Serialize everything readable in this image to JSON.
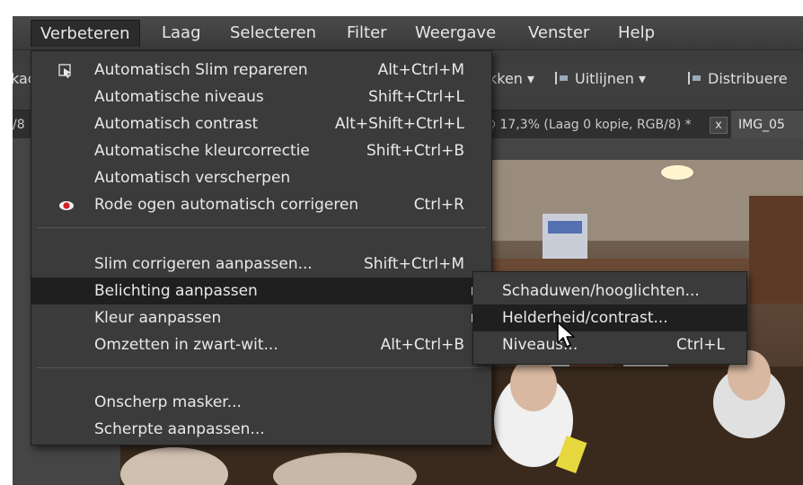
{
  "menubar": {
    "items": [
      {
        "label": "Verbeteren"
      },
      {
        "label": "Laag"
      },
      {
        "label": "Selecteren"
      },
      {
        "label": "Filter"
      },
      {
        "label": "Weergave"
      },
      {
        "label": "Venster"
      },
      {
        "label": "Help"
      }
    ]
  },
  "toolbar": {
    "left_fragment": "kac",
    "arrange_label": "kken ▾",
    "align_label": "Uitlijnen ▾",
    "distribute_label": "Distribuere"
  },
  "tabs": {
    "left_fragment": "/8",
    "doc_title": "@ 17,3% (Laag 0 kopie, RGB/8) *",
    "close_label": "x",
    "next_doc": "IMG_05"
  },
  "menu": {
    "items": [
      {
        "label": "Automatisch Slim repareren",
        "shortcut": "Alt+Ctrl+M"
      },
      {
        "label": "Automatische niveaus",
        "shortcut": "Shift+Ctrl+L"
      },
      {
        "label": "Automatisch contrast",
        "shortcut": "Alt+Shift+Ctrl+L"
      },
      {
        "label": "Automatische kleurcorrectie",
        "shortcut": "Shift+Ctrl+B"
      },
      {
        "label": "Automatisch verscherpen",
        "shortcut": ""
      },
      {
        "label": "Rode ogen automatisch corrigeren",
        "shortcut": "Ctrl+R"
      },
      {
        "label": "Slim corrigeren aanpassen...",
        "shortcut": "Shift+Ctrl+M"
      },
      {
        "label": "Belichting aanpassen",
        "shortcut": ""
      },
      {
        "label": "Kleur aanpassen",
        "shortcut": ""
      },
      {
        "label": "Omzetten in zwart-wit...",
        "shortcut": "Alt+Ctrl+B"
      },
      {
        "label": "Onscherp masker...",
        "shortcut": ""
      },
      {
        "label": "Scherpte aanpassen...",
        "shortcut": ""
      }
    ]
  },
  "submenu": {
    "items": [
      {
        "label": "Schaduwen/hooglichten...",
        "shortcut": ""
      },
      {
        "label": "Helderheid/contrast...",
        "shortcut": ""
      },
      {
        "label": "Niveaus...",
        "shortcut": "Ctrl+L"
      }
    ]
  },
  "colors": {
    "menu_bg": "#3b3b3b",
    "highlight": "#1f1f1f",
    "text": "#e9e9e9",
    "red_eye": "#d42020"
  }
}
